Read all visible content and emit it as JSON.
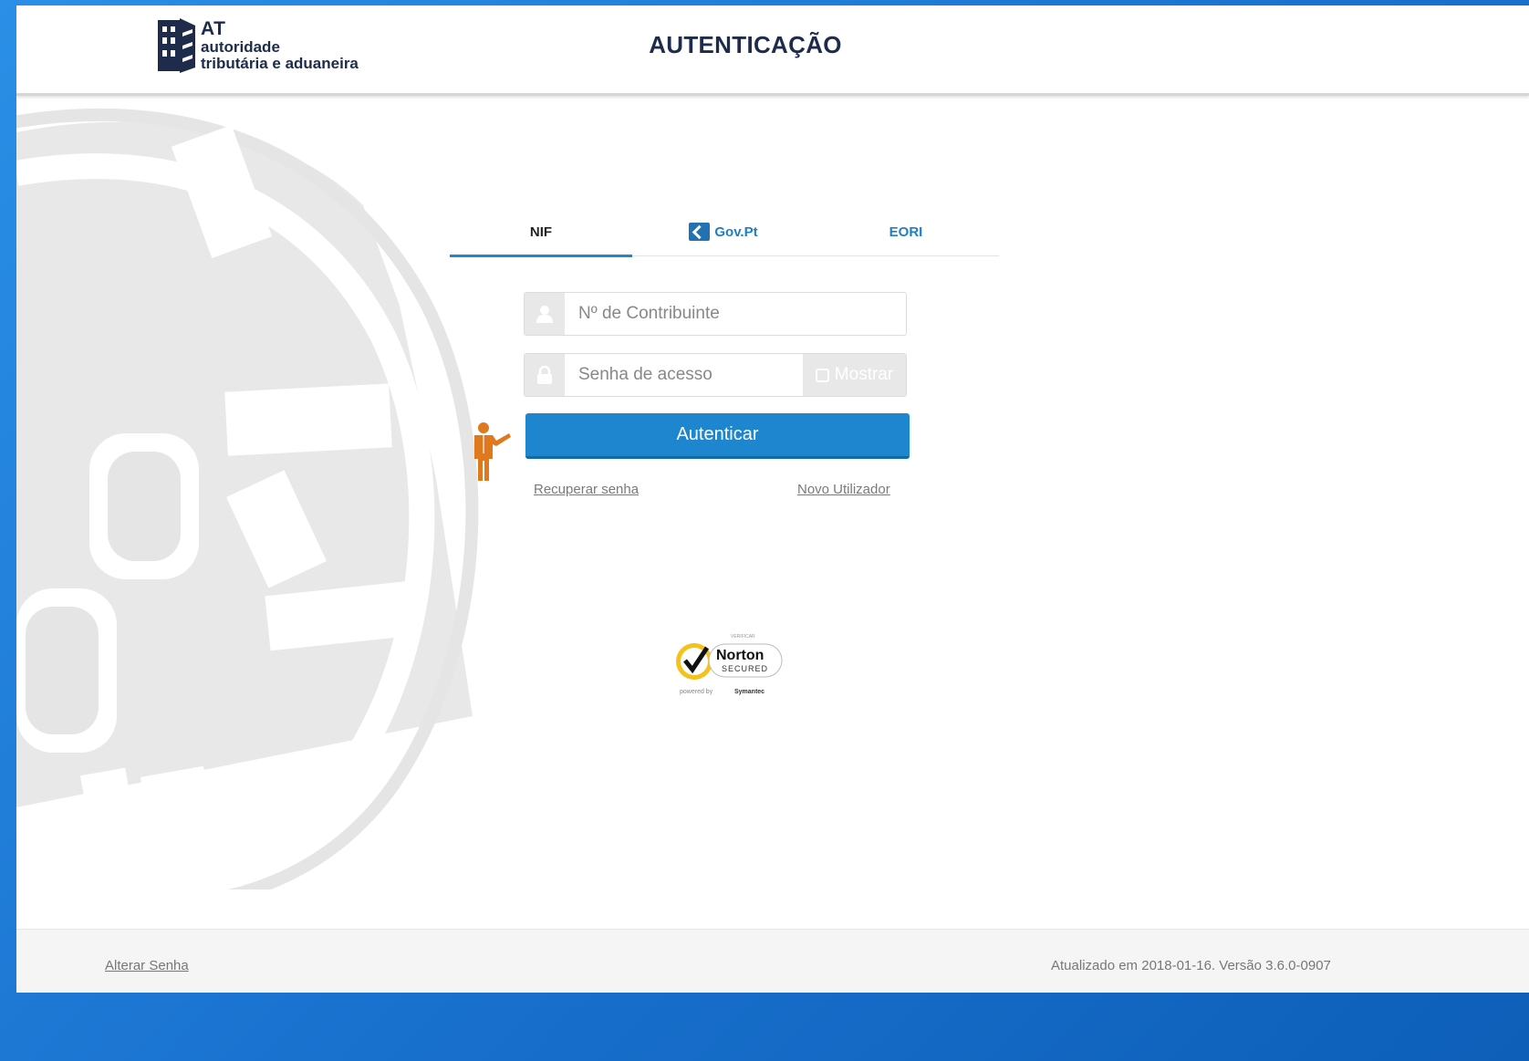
{
  "header": {
    "logo": {
      "line_at": "AT",
      "line_1": "autoridade",
      "line_2": "tributária e aduaneira"
    },
    "title": "AUTENTICAÇÃO"
  },
  "tabs": [
    {
      "label": "NIF",
      "active": true
    },
    {
      "label": "Gov.Pt",
      "active": false,
      "icon": "gov-pt-icon"
    },
    {
      "label": "EORI",
      "active": false
    }
  ],
  "form": {
    "nif": {
      "placeholder": "Nº de Contribuinte",
      "value": "",
      "icon": "user-icon"
    },
    "password": {
      "placeholder": "Senha de acesso",
      "value": "",
      "icon": "lock-icon"
    },
    "show_label": "Mostrar",
    "submit_label": "Autenticar",
    "recover_label": "Recuperar senha",
    "new_user_label": "Novo Utilizador"
  },
  "badge": {
    "top": "VERIFICAR",
    "name": "Norton",
    "sub": "SECURED",
    "powered_prefix": "powered by",
    "powered_brand": "Symantec"
  },
  "footer": {
    "change_password": "Alterar Senha",
    "version_text": "Atualizado em 2018-01-16. Versão 3.6.0-0907"
  },
  "colors": {
    "primary": "#1e86cf",
    "accent_orange": "#e0781e",
    "title_navy": "#1e2b4a"
  }
}
